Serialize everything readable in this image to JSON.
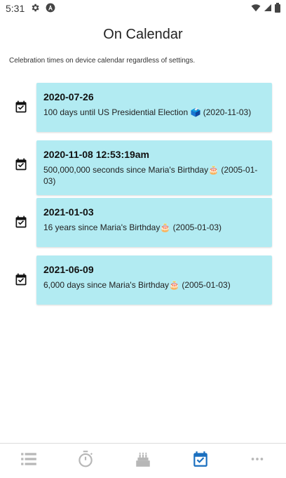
{
  "status_bar": {
    "time": "5:31"
  },
  "page": {
    "title": "On Calendar",
    "subtitle": "Celebration times on device calendar regardless of settings."
  },
  "events": [
    {
      "date": "2020-07-26",
      "description": "100 days until US Presidential Election 🗳️ (2020-11-03)"
    },
    {
      "date": "2020-11-08 12:53:19am",
      "description": "500,000,000 seconds since Maria's Birthday🎂 (2005-01-03)"
    },
    {
      "date": "2021-01-03",
      "description": "16 years since Maria's Birthday🎂 (2005-01-03)"
    },
    {
      "date": "2021-06-09",
      "description": "6,000 days since Maria's Birthday🎂 (2005-01-03)"
    }
  ],
  "nav": {
    "items": [
      {
        "icon": "list-icon",
        "active": false
      },
      {
        "icon": "stopwatch-icon",
        "active": false
      },
      {
        "icon": "cake-icon",
        "active": false
      },
      {
        "icon": "calendar-check-icon",
        "active": true
      },
      {
        "icon": "more-icon",
        "active": false
      }
    ],
    "active_color": "#1a6fbf",
    "inactive_color": "#b7b7b7"
  },
  "colors": {
    "card_bg": "#b2ebf2"
  }
}
